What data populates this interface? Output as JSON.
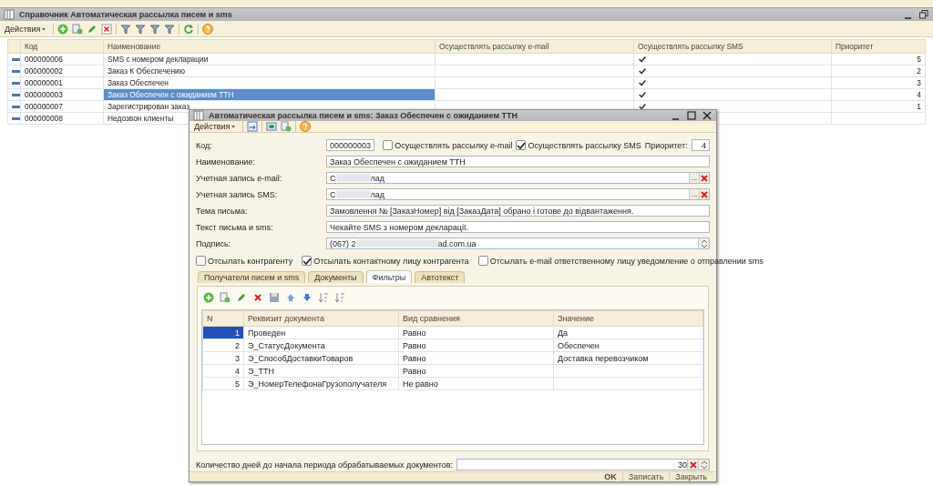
{
  "main_window": {
    "title": "Справочник Автоматическая рассылка писем и sms",
    "actions_label": "Действия",
    "table": {
      "columns": [
        "Код",
        "Наименование",
        "Осуществлять рассылку e-mail",
        "Осуществлять рассылку SMS",
        "Приоритет"
      ],
      "rows": [
        {
          "code": "000000006",
          "name": "SMS с номером декларации",
          "sms": true,
          "priority": "5",
          "selected": false
        },
        {
          "code": "000000002",
          "name": "Заказ К Обеспечению",
          "sms": true,
          "priority": "2",
          "selected": false
        },
        {
          "code": "000000001",
          "name": "Заказ Обеспечен",
          "sms": true,
          "priority": "3",
          "selected": false
        },
        {
          "code": "000000003",
          "name": "Заказ Обеспечен с ожиданием ТТН",
          "sms": true,
          "priority": "4",
          "selected": true
        },
        {
          "code": "000000007",
          "name": "Зарегистрирован заказ",
          "sms": true,
          "priority": "1",
          "selected": false
        },
        {
          "code": "000000008",
          "name": "Недозвон клиенты",
          "selected": false
        }
      ]
    }
  },
  "dialog": {
    "title": "Автоматическая рассылка писем и sms: Заказ Обеспечен с ожиданием ТТН",
    "actions_label": "Действия",
    "code": {
      "label": "Код:",
      "value": "000000003"
    },
    "send_email": {
      "label": "Осуществлять рассылку e-mail",
      "checked": false
    },
    "send_sms": {
      "label": "Осуществлять рассылку SMS",
      "checked": true
    },
    "priority": {
      "label": "Приоритет:",
      "value": "4"
    },
    "name": {
      "label": "Наименование:",
      "value": "Заказ Обеспечен с ожиданием ТТН"
    },
    "email_account": {
      "label": "Учетная запись e-mail:",
      "value_start": "С",
      "value_end": "лад",
      "select_button": "..."
    },
    "sms_account": {
      "label": "Учетная запись SMS:",
      "value_start": "С",
      "value_end": "лад",
      "select_button": "..."
    },
    "subject": {
      "label": "Тема письма:",
      "value": "Замовлення № [ЗаказНомер] від [ЗаказДата] обрано і готове до відвантаження."
    },
    "message": {
      "label": "Текст письма и sms:",
      "value": "Чекайте SMS з номером декларації."
    },
    "signature": {
      "label": "Подпись:",
      "value_start": "(067) 2",
      "value_end": "ad.com.ua"
    },
    "options": [
      {
        "label": "Отсылать контрагенту",
        "checked": false
      },
      {
        "label": "Отсылать контактному лицу контрагента",
        "checked": true
      },
      {
        "label": "Отсылать e-mail ответственному лицу уведомление о отправлении sms",
        "checked": false
      }
    ],
    "tabs": [
      {
        "label": "Получатели писем и sms",
        "selected": false
      },
      {
        "label": "Документы",
        "selected": false
      },
      {
        "label": "Фильтры",
        "selected": true
      },
      {
        "label": "Автотекст",
        "selected": false
      }
    ],
    "filters": {
      "columns": [
        "N",
        "Реквизит документа",
        "Вид сравнения",
        "Значение"
      ],
      "rows": [
        {
          "n": "1",
          "attribute": "Проведен",
          "comparison": "Равно",
          "value": "Да",
          "selected": true
        },
        {
          "n": "2",
          "attribute": "Э_СтатусДокумента",
          "comparison": "Равно",
          "value": "Обеспечен",
          "selected": false
        },
        {
          "n": "3",
          "attribute": "Э_СпособДоставкиТоваров",
          "comparison": "Равно",
          "value": "Доставка перевозчиком",
          "selected": false
        },
        {
          "n": "4",
          "attribute": "Э_ТТН",
          "comparison": "Равно",
          "selected": false
        },
        {
          "n": "5",
          "attribute": "Э_НомерТелефонаГрузополучателя",
          "comparison": "Не равно",
          "selected": false
        }
      ]
    },
    "days": {
      "label": "Количество дней до начала периода обрабатываемых документов:",
      "value": "30"
    },
    "buttons": [
      {
        "label": "OK",
        "kind": "default"
      },
      {
        "label": "Записать",
        "kind": "normal"
      },
      {
        "label": "Закрыть",
        "kind": "normal"
      }
    ]
  }
}
